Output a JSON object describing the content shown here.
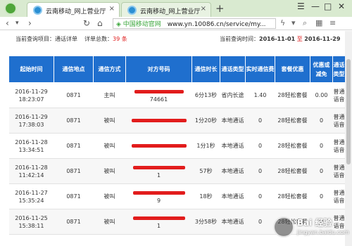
{
  "browser": {
    "tabs": [
      {
        "title": "云南移动_网上营业厅",
        "close": "×"
      },
      {
        "title": "云南移动_网上营业厅",
        "close": "×"
      }
    ],
    "new_tab": "+",
    "window_controls": [
      "☰",
      "—",
      "□",
      "✕"
    ],
    "nav": {
      "back": "‹",
      "back_menu": "▾",
      "forward": "›",
      "reload": "↻",
      "home": "⌂"
    },
    "address": {
      "site_label": "中国移动官网",
      "url": "www.yn.10086.cn/service/my..."
    }
  },
  "query": {
    "project_label": "当前查询项目：",
    "project_value": "通话详单",
    "total_label": "详单总数：",
    "total_value": "39",
    "total_unit": "条",
    "time_label": "当前查询时间：",
    "start_date": "2016-11-01",
    "to": "至",
    "end_date": "2016-11-29"
  },
  "table": {
    "headers": [
      "起始时间",
      "通信地点",
      "通信方式",
      "对方号码",
      "通信时长",
      "通话类型",
      "实时通信费",
      "套餐优惠",
      "优惠或减免",
      "通话类型"
    ],
    "rows": [
      {
        "start": "2016-11-29 18:23:07",
        "place": "0871",
        "mode": "主叫",
        "number_tail": "74661",
        "duration": "6分13秒",
        "call_type": "省内长途",
        "fee": "1.40",
        "package": "28轻松套餐",
        "discount": "0.00",
        "type2": "普通语音"
      },
      {
        "start": "2016-11-29 17:38:03",
        "place": "0871",
        "mode": "被叫",
        "number_tail": "",
        "duration": "1分20秒",
        "call_type": "本地通话",
        "fee": "0",
        "package": "28轻松套餐",
        "discount": "0",
        "type2": "普通语音"
      },
      {
        "start": "2016-11-28 13:34:51",
        "place": "0871",
        "mode": "被叫",
        "number_tail": "",
        "duration": "1分1秒",
        "call_type": "本地通话",
        "fee": "0",
        "package": "28轻松套餐",
        "discount": "0",
        "type2": "普通语音"
      },
      {
        "start": "2016-11-28 11:42:14",
        "place": "0871",
        "mode": "被叫",
        "number_tail": "1",
        "duration": "57秒",
        "call_type": "本地通话",
        "fee": "0",
        "package": "28轻松套餐",
        "discount": "0",
        "type2": "普通语音"
      },
      {
        "start": "2016-11-27 15:35:24",
        "place": "0871",
        "mode": "被叫",
        "number_tail": "9",
        "duration": "18秒",
        "call_type": "本地通话",
        "fee": "0",
        "package": "28轻松套餐",
        "discount": "0",
        "type2": "普通语音"
      },
      {
        "start": "2016-11-25 15:38:11",
        "place": "0871",
        "mode": "被叫",
        "number_tail": "1",
        "duration": "3分58秒",
        "call_type": "本地通话",
        "fee": "0",
        "package": "28轻松套餐",
        "discount": "0",
        "type2": "普通语音"
      }
    ]
  },
  "watermark": {
    "line1": "Bai 经验",
    "line2": "jingyan.baidu.com"
  },
  "colors": {
    "header_bg": "#1f6fce",
    "redaction": "#e21c1c",
    "accent_red": "#e02020"
  }
}
